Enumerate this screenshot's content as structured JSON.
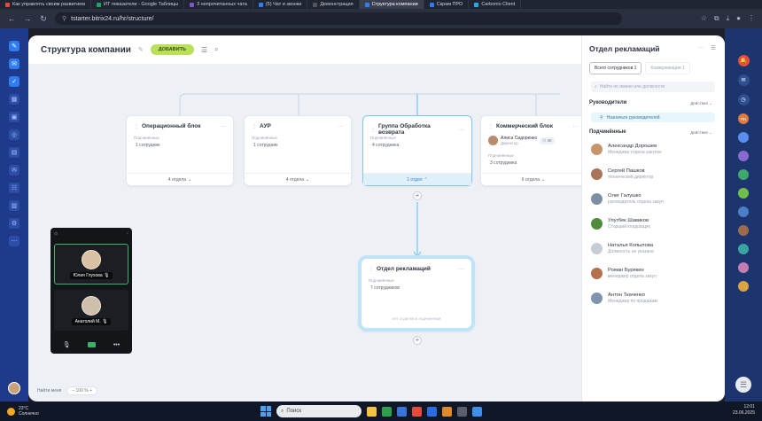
{
  "browser": {
    "tabs": [
      {
        "label": "Как управлять своим развитием",
        "color": "#e04b3c"
      },
      {
        "label": "ИТ показатели - Google Таблицы",
        "color": "#1fa463"
      },
      {
        "label": "3 непрочитанных чата",
        "color": "#7e57c2"
      },
      {
        "label": "(5) Чат и звонки",
        "color": "#2f7df0"
      },
      {
        "label": "Демонстрация",
        "color": "#3a3f4f"
      },
      {
        "label": "Структура компании",
        "color": "#2f7df0"
      },
      {
        "label": "Скрам ПРО",
        "color": "#2f7df0"
      },
      {
        "label": "Carbonio Client",
        "color": "#2fa4e7"
      }
    ],
    "active_tab_index": 5,
    "url": "tstarter.bitrix24.ru/hr/structure/"
  },
  "header": {
    "title": "Структура компании",
    "add_label": "ДОБАВИТЬ"
  },
  "org": {
    "cards": [
      {
        "title": "Операционный блок",
        "sub_label": "Подчинённые",
        "employees": "1 сотрудник",
        "footer": "4 отдела"
      },
      {
        "title": "АУР",
        "sub_label": "Подчинённые",
        "employees": "1 сотрудник",
        "footer": "4 отдела"
      },
      {
        "title": "Группа Обработка возврата",
        "sub_label": "Подчинённые",
        "employees": "4 сотрудника",
        "footer": "1 отдел"
      },
      {
        "title": "Коммерческий блок",
        "manager_name": "Алиса Сидоренко",
        "manager_role": "Директор",
        "manager_badge": "40",
        "sub_label": "Подчинённые",
        "employees": "3 сотрудника",
        "footer": "6 отдела"
      }
    ],
    "selected_card": {
      "title": "Отдел рекламаций",
      "sub_label": "Подчинённые",
      "employees": "7 сотрудников",
      "empty_note": "нет отделов в подчинении"
    }
  },
  "footer": {
    "find_label": "Найти меня",
    "zoom": "100 %"
  },
  "video": {
    "participants": [
      {
        "name": "Юлия Глухова",
        "active": true
      },
      {
        "name": "Анатолий М.",
        "active": false
      }
    ]
  },
  "panel": {
    "title": "Отдел рекламаций",
    "tabs": [
      {
        "label": "Всего сотрудников",
        "count": "1"
      },
      {
        "label": "Коммуникации",
        "count": "1"
      }
    ],
    "search_placeholder": "Найти по имени или должности",
    "managers_label": "Руководители",
    "managers_action": "Действия",
    "assign_label": "Назначьте руководителей",
    "subordinates_label": "Подчинённые",
    "subordinates_action": "Действия",
    "employees": [
      {
        "name": "Александр Дорошев",
        "position": "Менеджер отдела закупок",
        "color": "#c8946c"
      },
      {
        "name": "Сергей Пашков",
        "position": "технический директор",
        "color": "#a9745a"
      },
      {
        "name": "Олег Галушко",
        "position": "руководитель отдела закуп",
        "color": "#7d8fa3"
      },
      {
        "name": "Улугбек Шавиков",
        "position": "Старший кладовщик",
        "color": "#4f8a3d"
      },
      {
        "name": "Наталья Копылова",
        "position": "Должность не указана",
        "color": "#c7ccd6"
      },
      {
        "name": "Роман Бурякин",
        "position": "менеджер отдела закуп",
        "color": "#b5714d"
      },
      {
        "name": "Антон Ткаченко",
        "position": "Менеджер по продажам",
        "color": "#7f94ad"
      }
    ]
  },
  "taskbar": {
    "temperature": "23°C",
    "weather": "Солнечно",
    "search_label": "Поиск",
    "time": "12:01",
    "date": "23.06.2025"
  }
}
